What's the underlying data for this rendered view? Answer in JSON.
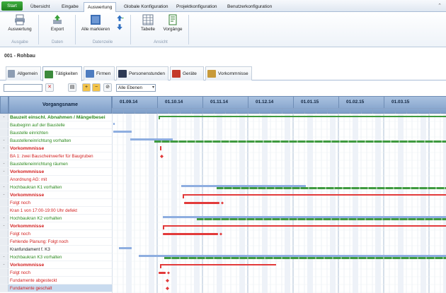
{
  "menu": {
    "start": "Start",
    "tabs": [
      "Übersicht",
      "Eingabe",
      "Auswertung",
      "Globale Konfiguration",
      "Projektkonfiguration",
      "Benutzerkonfiguration"
    ],
    "active_tab": "Auswertung"
  },
  "ribbon": {
    "buttons": [
      {
        "label": "Auswertung",
        "group": "Ausgabe"
      },
      {
        "label": "Export",
        "group": "Daten"
      },
      {
        "label": "Alle markieren",
        "group": "Datenzeile"
      },
      {
        "label": "Tabelle",
        "group": "Ansicht"
      },
      {
        "label": "Vorgänge",
        "group": "Ansicht"
      }
    ],
    "groups": [
      "Ausgabe",
      "Daten",
      "Datenzeile",
      "Ansicht"
    ]
  },
  "project": {
    "title": "001 - Rohbau"
  },
  "tabs": [
    {
      "label": "Allgemein"
    },
    {
      "label": "Tätigkeiten"
    },
    {
      "label": "Firmen"
    },
    {
      "label": "Personenstunden"
    },
    {
      "label": "Geräte"
    },
    {
      "label": "Vorkommnisse"
    }
  ],
  "active_section_tab": "Tätigkeiten",
  "toolbar": {
    "search_value": "",
    "level_select": "Alle Ebenen"
  },
  "grid": {
    "column_header": "Vorgangsname",
    "months": [
      "01.09.14",
      "01.10.14",
      "01.11.14",
      "01.12.14",
      "01.01.15",
      "01.02.15",
      "01.03.15"
    ],
    "rows": [
      {
        "text": "Bauzeit einschl. Abnahmen / Mängelbesei",
        "style": "greenbold",
        "marker": "-"
      },
      {
        "text": "Baubeginn auf der Baustelle",
        "style": "green",
        "marker": ""
      },
      {
        "text": "Baustelle einrichten",
        "style": "green",
        "marker": ""
      },
      {
        "text": "Baustelleneinrichtung vorhalten",
        "style": "green",
        "marker": "-"
      },
      {
        "text": "Vorkommnisse",
        "style": "redbold",
        "marker": "-"
      },
      {
        "text": "BA 1: zwei Bauscheinwerfer für Baugruben",
        "style": "red",
        "marker": ""
      },
      {
        "text": "Baustelleneinrichtung räumen",
        "style": "green",
        "marker": "-"
      },
      {
        "text": "Vorkommnisse",
        "style": "redbold",
        "marker": "-"
      },
      {
        "text": "Anordnung AG: mit",
        "style": "red",
        "marker": ""
      },
      {
        "text": "Hochbaukran K1 vorhalten",
        "style": "green",
        "marker": "-"
      },
      {
        "text": "Vorkommnisse",
        "style": "redbold",
        "marker": "-"
      },
      {
        "text": "Folgt noch",
        "style": "red",
        "marker": ""
      },
      {
        "text": "Kran 1 von 17:00-19:00 Uhr defekt",
        "style": "red",
        "marker": ""
      },
      {
        "text": "Hochbaukran K2 vorhalten",
        "style": "green",
        "marker": "-"
      },
      {
        "text": "Vorkommnisse",
        "style": "redbold",
        "marker": "-"
      },
      {
        "text": "Folgt noch",
        "style": "red",
        "marker": ""
      },
      {
        "text": "Fehlende Planung: Folgt noch",
        "style": "red",
        "marker": ""
      },
      {
        "text": "Kranfundament f. K3",
        "style": "black",
        "marker": ""
      },
      {
        "text": "Hochbaukran K3 vorhalten",
        "style": "green",
        "marker": "-"
      },
      {
        "text": "Vorkommnisse",
        "style": "redbold",
        "marker": "-"
      },
      {
        "text": "Folgt noch",
        "style": "red",
        "marker": ""
      },
      {
        "text": "Fundamente abgesteckt",
        "style": "red",
        "marker": ""
      },
      {
        "text": "Fundamente geschalt",
        "style": "red",
        "marker": "",
        "selected": true
      }
    ]
  },
  "colors": {
    "plan_bar": "#8eaee0",
    "actual_bar": "#3f9a3f",
    "incident_bar": "#e23a3a",
    "header": "#8fabd3"
  }
}
